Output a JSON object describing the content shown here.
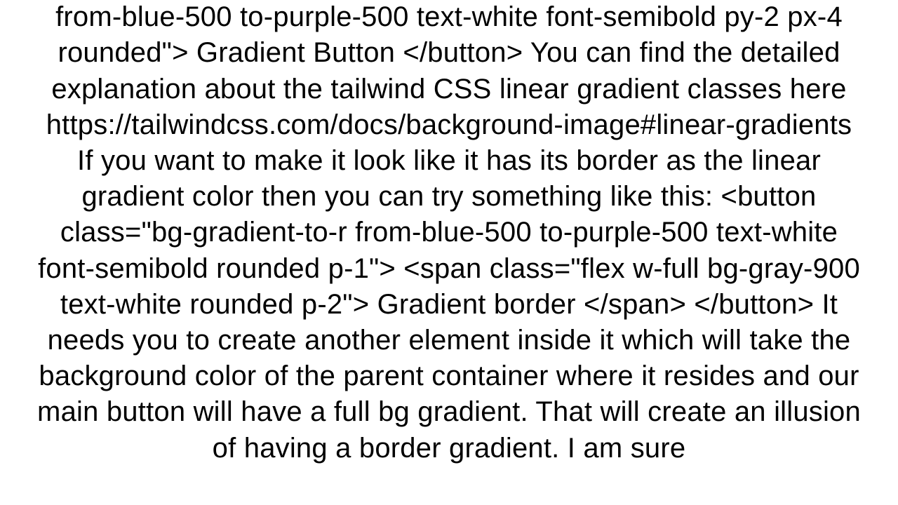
{
  "body_text": "from-blue-500 to-purple-500 text-white font-semibold py-2 px-4 rounded\">       Gradient Button     </button>  You can find the detailed explanation about the tailwind CSS linear gradient classes here https://tailwindcss.com/docs/background-image#linear-gradients If you want to make it look like it has its border as the linear gradient color then you can try something like this: <button class=\"bg-gradient-to-r from-blue-500 to-purple-500 text-white font-semibold rounded p-1\">   <span class=\"flex w-full bg-gray-900 text-white rounded p-2\">     Gradient border       </span> </button>  It needs you to create another element inside it which will take the background color of the parent container where it resides and our main button will have a full bg gradient. That will create an illusion of having a border gradient. I am sure"
}
